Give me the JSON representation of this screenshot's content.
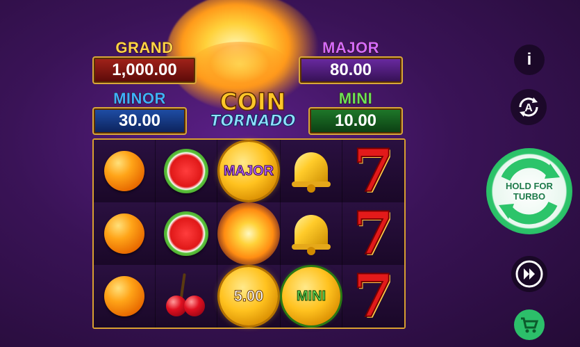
{
  "game": {
    "logo_line1": "COIN",
    "logo_line2": "TORNADO"
  },
  "jackpots": {
    "grand": {
      "label": "GRAND",
      "value": "1,000.00"
    },
    "major": {
      "label": "MAJOR",
      "value": "80.00"
    },
    "minor": {
      "label": "MINOR",
      "value": "30.00"
    },
    "mini": {
      "label": "MINI",
      "value": "10.00"
    }
  },
  "reels": {
    "rows": [
      [
        "orange",
        "watermelon",
        "coin-major",
        "bell",
        "seven"
      ],
      [
        "orange",
        "watermelon",
        "fireball",
        "bell",
        "seven"
      ],
      [
        "orange",
        "cherry",
        "coin-value",
        "coin-mini",
        "seven"
      ]
    ],
    "coin_labels": {
      "major": "MAJOR",
      "value": "5.00",
      "mini": "MINI"
    }
  },
  "controls": {
    "info_label": "i",
    "turbo_line1": "HOLD FOR",
    "turbo_line2": "TURBO",
    "icons": [
      "info-icon",
      "autoplay-icon",
      "turbo-spin-icon",
      "fast-forward-icon",
      "cart-icon"
    ]
  },
  "colors": {
    "grand": "#a3231a",
    "major": "#6b2aa3",
    "minor": "#1f4fa8",
    "mini": "#1f7a2a",
    "frame": "#d9a030",
    "turbo": "#2cc46a"
  }
}
